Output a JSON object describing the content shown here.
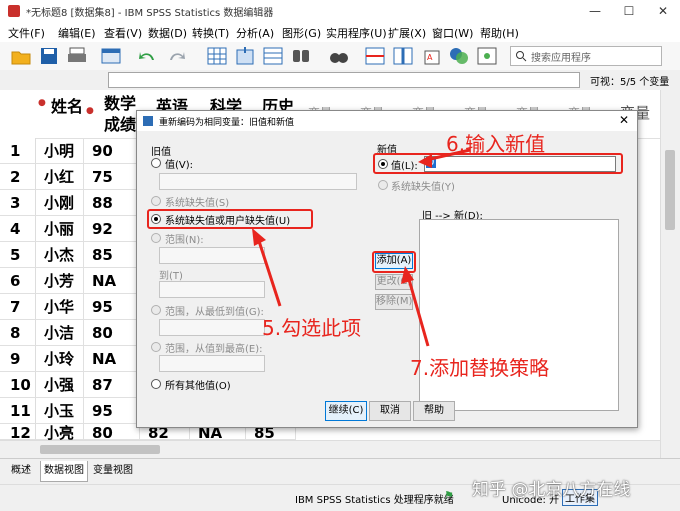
{
  "window": {
    "title": "*无标题8 [数据集8] - IBM SPSS Statistics 数据编辑器",
    "controls": [
      "—",
      "☐",
      "✕"
    ]
  },
  "menu": [
    "文件(F)",
    "编辑(E)",
    "查看(V)",
    "数据(D)",
    "转换(T)",
    "分析(A)",
    "图形(G)",
    "实用程序(U)",
    "扩展(X)",
    "窗口(W)",
    "帮助(H)"
  ],
  "toolbar": {
    "search_placeholder": "搜索应用程序"
  },
  "formula_bar": {
    "visible_label": "可视：5/5 个变量"
  },
  "grid": {
    "columns": [
      "姓名",
      "数学成绩",
      "英语",
      "科学",
      "历史",
      "变量",
      "变量",
      "变量",
      "变量",
      "变量",
      "变量",
      "变量",
      "变量"
    ],
    "visible_row_values": [
      [
        "1",
        "小明",
        "90"
      ],
      [
        "2",
        "小红",
        "75"
      ],
      [
        "3",
        "小刚",
        "88"
      ],
      [
        "4",
        "小丽",
        "92"
      ],
      [
        "5",
        "小杰",
        "85"
      ],
      [
        "6",
        "小芳",
        "NA"
      ],
      [
        "7",
        "小华",
        "95"
      ],
      [
        "8",
        "小洁",
        "80"
      ],
      [
        "9",
        "小玲",
        "NA"
      ],
      [
        "10",
        "小强",
        "87"
      ],
      [
        "11",
        "小玉",
        "95"
      ],
      [
        "12",
        "小亮",
        "80",
        "82",
        "NA",
        "85"
      ]
    ]
  },
  "bottom_tabs": [
    "概述",
    "数据视图",
    "变量视图"
  ],
  "status": {
    "processor": "IBM SPSS Statistics 处理程序就绪",
    "unicode": "Unicode: 开",
    "watermark": "知乎 @北京八方在线",
    "misc": "工作集"
  },
  "dialog": {
    "title": "重新编码为相同变量：旧值和新值",
    "old_value_section": "旧值",
    "old_options": {
      "value": "值(V):",
      "system_missing": "系统缺失值(S)",
      "system_or_user_missing": "系统缺失值或用户缺失值(U)",
      "range": "范围(N):",
      "through": "到(T)",
      "range_lowest": "范围，从最低到值(G):",
      "range_highest": "范围，从值到最高(E):",
      "all_other": "所有其他值(O)"
    },
    "new_value_section": "新值",
    "new_options": {
      "value": "值(L):",
      "value_input": "0",
      "system_missing": "系统缺失值(Y)"
    },
    "old_new_label": "旧 --> 新(D):",
    "buttons": {
      "add": "添加(A)",
      "change": "更改(C)",
      "remove": "移除(M)",
      "continue": "继续(C)",
      "cancel": "取消",
      "help": "帮助"
    }
  },
  "annotations": {
    "step5": "5.勾选此项",
    "step6": "6.输入新值",
    "step7": "7.添加替换策略",
    "color": "#e8251e"
  }
}
